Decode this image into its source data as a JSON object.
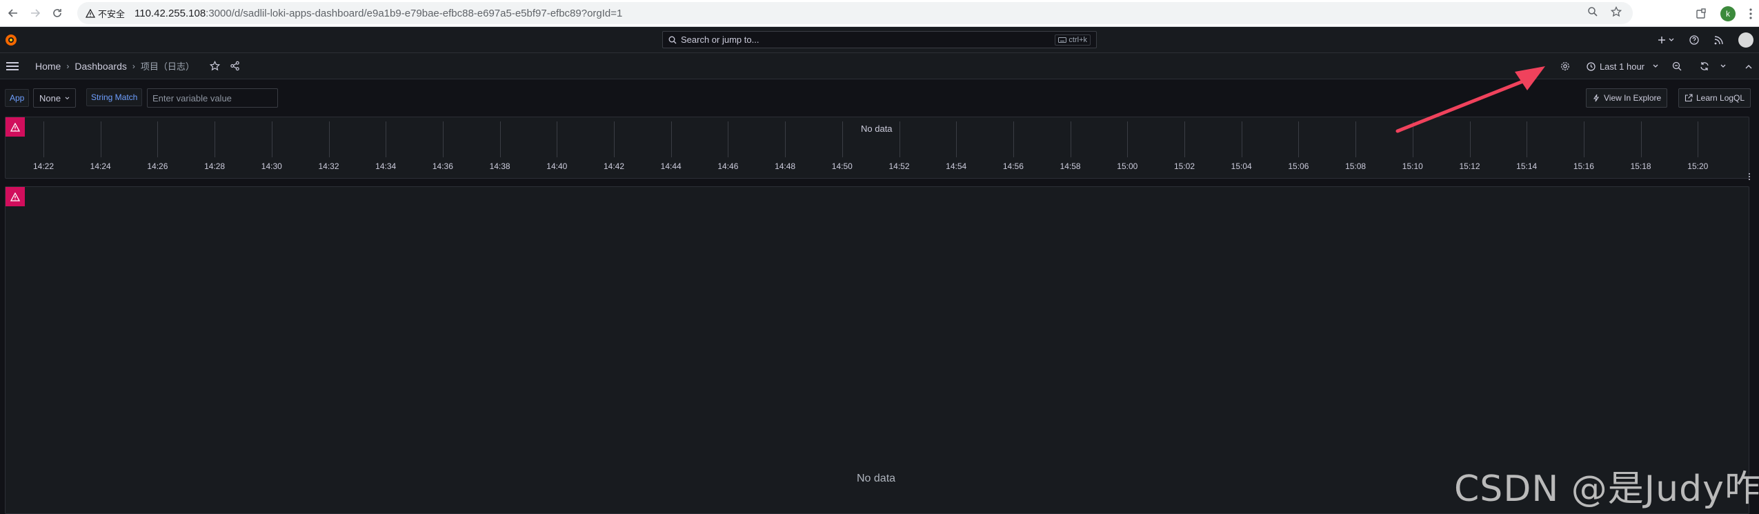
{
  "browser": {
    "security_label": "不安全",
    "url_host": "110.42.255.108",
    "url_path": ":3000/d/sadlil-loki-apps-dashboard/e9a1b9-e79bae-efbc88-e697a5-e5bf97-efbc89?orgId=1",
    "profile_initial": "k"
  },
  "topbar": {
    "search_placeholder": "Search or jump to...",
    "search_shortcut": "ctrl+k"
  },
  "breadcrumb": {
    "home": "Home",
    "dashboards": "Dashboards",
    "current": "项目（日志）"
  },
  "toolbar": {
    "time_range": "Last 1 hour"
  },
  "variables": {
    "app_label": "App",
    "app_value": "None",
    "string_match_label": "String Match",
    "string_match_placeholder": "Enter variable value",
    "view_in_explore": "View In Explore",
    "learn_logql": "Learn LogQL"
  },
  "panels": {
    "graph_nodata": "No data",
    "logs_nodata": "No data",
    "time_ticks": [
      "14:22",
      "14:24",
      "14:26",
      "14:28",
      "14:30",
      "14:32",
      "14:34",
      "14:36",
      "14:38",
      "14:40",
      "14:42",
      "14:44",
      "14:46",
      "14:48",
      "14:50",
      "14:52",
      "14:54",
      "14:56",
      "14:58",
      "15:00",
      "15:02",
      "15:04",
      "15:06",
      "15:08",
      "15:10",
      "15:12",
      "15:14",
      "15:16",
      "15:18",
      "15:20"
    ]
  },
  "watermark": "CSDN @是Judy咋！",
  "colors": {
    "error_badge": "#d10e5c",
    "annotation_arrow": "#f0425c"
  }
}
